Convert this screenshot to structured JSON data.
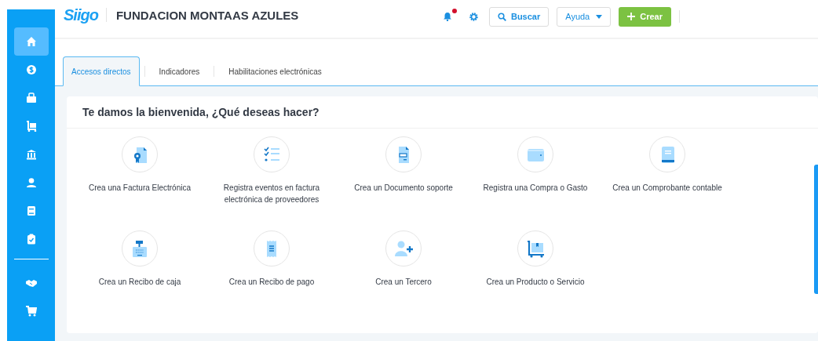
{
  "sidebar": {
    "items": [
      {
        "selected": true
      },
      {
        "selected": false
      },
      {
        "selected": false
      },
      {
        "selected": false
      },
      {
        "selected": false
      },
      {
        "selected": false
      },
      {
        "selected": false
      },
      {
        "selected": false
      },
      {
        "selected": false
      },
      {
        "selected": false
      }
    ]
  },
  "header": {
    "logo": "Siigo",
    "company": "FUNDACION MONTAAS AZULES",
    "notifications": {
      "unread": true
    },
    "search_button": "Buscar",
    "help_button": "Ayuda",
    "create_button": "Crear"
  },
  "tabs": [
    {
      "label": "Accesos directos",
      "selected": true
    },
    {
      "label": "Indicadores",
      "selected": false
    },
    {
      "label": "Habilitaciones electrónicas",
      "selected": false
    }
  ],
  "welcome": {
    "title": "Te damos la bienvenida, ¿Qué deseas hacer?",
    "shortcuts": [
      {
        "label": "Crea una Factura Electrónica"
      },
      {
        "label": "Registra eventos en factura electrónica de proveedores"
      },
      {
        "label": "Crea un Documento soporte"
      },
      {
        "label": "Registra una Compra o Gasto"
      },
      {
        "label": "Crea un Comprobante contable"
      },
      {
        "label": "Crea un Recibo de caja"
      },
      {
        "label": "Crea un Recibo de pago"
      },
      {
        "label": "Crea un Tercero"
      },
      {
        "label": "Crea un Producto o Servicio"
      }
    ]
  }
}
